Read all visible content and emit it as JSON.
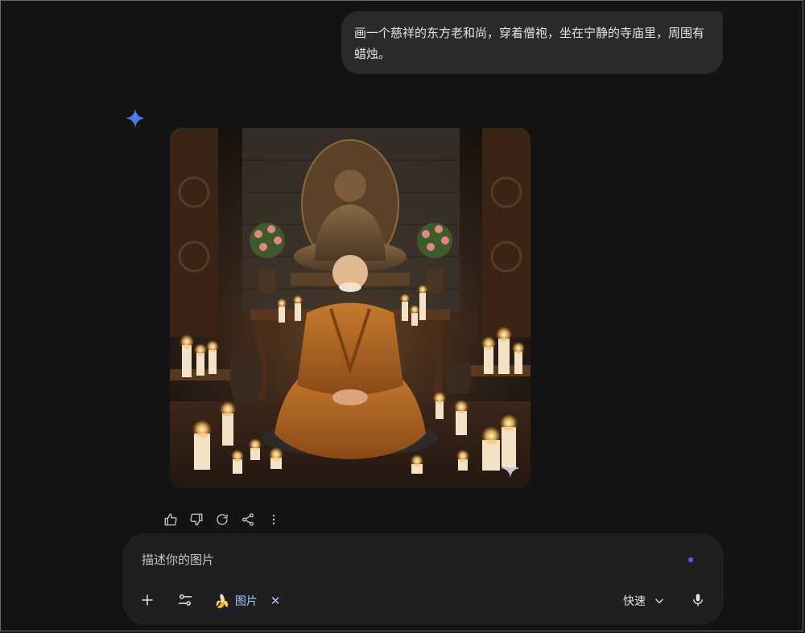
{
  "conversation": {
    "user_prompt": "画一个慈祥的东方老和尚，穿着僧袍，坐在宁静的寺庙里，周围有蜡烛。"
  },
  "response": {
    "image_subject": "Elderly monk in saffron robes meditating in a candle-lit temple before a Buddha statue"
  },
  "actions": {
    "icons": [
      "thumb-up-icon",
      "thumb-down-icon",
      "regenerate-icon",
      "share-icon",
      "more-vert-icon"
    ]
  },
  "composer": {
    "placeholder": "描述你的图片",
    "chip_emoji": "🍌",
    "chip_label": "图片",
    "chip_close": "✕",
    "mode_label": "快速"
  },
  "colors": {
    "background": "#131314",
    "bubble": "#282a2c",
    "panel": "#1e1f20",
    "accent_blue": "#4285f4",
    "chip_text": "#a8c7fa",
    "dot_purple": "#8b3dff"
  }
}
